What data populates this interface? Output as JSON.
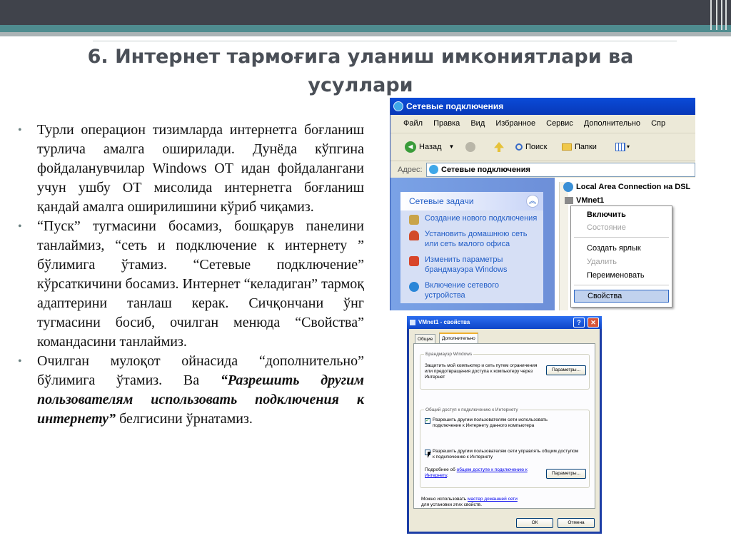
{
  "slide": {
    "title": "6. Интернет тармоғига уланиш имкониятлари ва усуллари",
    "bullets": [
      {
        "text": "Турли операцион тизимларда интернетга боғланиш турлича амалга оширилади. Дунёда кўпгина фойдаланувчилар Windows ОТ идан фойдалангани учун ушбу ОТ мисолида интернетга боғланиш қандай амалга оширилишини кўриб чиқамиз."
      },
      {
        "text": "“Пуск” тугмасини босамиз, бошқарув панелини танлаймиз, “сеть и подключение к интернету ” бўлимига ўтамиз. “Сетевые подключение” кўрсаткичини босамиз. Интернет “келадиган” тармоқ адаптерини танлаш керак. Сичқончани ўнг тугмасини босиб, очилган менюда “Свойства” командасини танлаймиз."
      },
      {
        "text_before": "Очилган мулоқот ойнасида “дополнительно” бўлимига ўтамиз. Ва ",
        "text_bold": "“Разрешить другим пользователям использовать подключения к интернету”",
        "text_after": " белгисини ўрнатамиз."
      }
    ]
  },
  "screenshot1": {
    "window_title": "Сетевые подключения",
    "menu": [
      "Файл",
      "Правка",
      "Вид",
      "Избранное",
      "Сервис",
      "Дополнительно",
      "Спр"
    ],
    "toolbar": {
      "back": "Назад",
      "search": "Поиск",
      "folders": "Папки"
    },
    "address_label": "Адрес:",
    "address_value": "Сетевые подключения",
    "tasks_title": "Сетевые задачи",
    "tasks": [
      "Создание нового подключения",
      "Установить домашнюю сеть или сеть малого офиса",
      "Изменить параметры брандмауэра Windows",
      "Включение сетевого устройства"
    ],
    "connections": [
      "Local Area Connection на DSL",
      "VMnet1"
    ],
    "context_menu": {
      "enable": "Включить",
      "status": "Состояние",
      "create_shortcut": "Создать ярлык",
      "delete": "Удалить",
      "rename": "Переименовать",
      "properties": "Свойства"
    }
  },
  "screenshot2": {
    "title": "VMnet1 - свойства",
    "help_btn": "?",
    "close_btn": "✕",
    "tabs": [
      "Общие",
      "Дополнительно"
    ],
    "firewall_group": "Брандмауэр Windows",
    "firewall_text": "Защитить мой компьютер и сеть путем ограничения или предотвращения доступа к компьютеру через Интернет",
    "params_btn": "Параметры...",
    "sharing_group": "Общий доступ к подключению к Интернету",
    "allow_use": "Разрешить другим пользователям сети использовать подключение к Интернету данного компьютера",
    "allow_control": "Разрешить другим пользователям сети управлять общим доступом к подключению к Интернету",
    "more_prefix": "Подробнее об ",
    "more_link": "общем доступе к подключению к Интернету",
    "more_suffix": ".",
    "params_btn2": "Параметры...",
    "bottom_prefix": "Можно использовать ",
    "bottom_link": "мастер домашней сети",
    "bottom_suffix": "для установки этих свойств.",
    "ok": "ОК",
    "cancel": "Отмена"
  },
  "colors": {
    "topbar": "#40434b",
    "teal": "#4f8c8f",
    "title": "#4a4f57",
    "bullet": "#6a8080",
    "xp_blue": "#0a4bd8"
  }
}
